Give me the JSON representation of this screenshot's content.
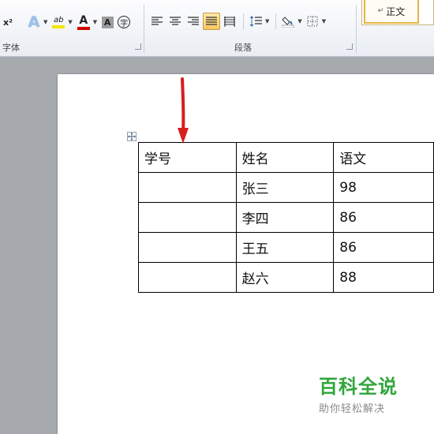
{
  "ribbon": {
    "font_group_label": "字体",
    "paragraph_group_label": "段落",
    "font_tools": {
      "superscript": "x²",
      "text_effects": "A",
      "highlight": "ab",
      "font_color": "A",
      "char_shading": "A",
      "enclose_char": "字"
    },
    "style_gallery": {
      "para_mark": "↵",
      "active_style": "正文"
    }
  },
  "document": {
    "table": {
      "headers": [
        "学号",
        "姓名",
        "语文"
      ],
      "rows": [
        [
          "",
          "张三",
          "98"
        ],
        [
          "",
          "李四",
          "86"
        ],
        [
          "",
          "王五",
          "86"
        ],
        [
          "",
          "赵六",
          "88"
        ]
      ]
    }
  },
  "watermark": {
    "title": "百科全说",
    "subtitle": "助你轻松解决"
  },
  "colors": {
    "highlight": "#f5e500",
    "font_color": "#d40000",
    "active_button": "#f8c95d",
    "arrow": "#d61f1f",
    "watermark": "#31a63c"
  }
}
